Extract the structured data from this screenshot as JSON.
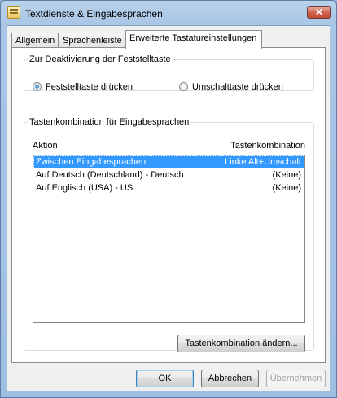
{
  "window": {
    "title": "Textdienste & Eingabesprachen",
    "close_label": "✕"
  },
  "tabs": [
    {
      "label": "Allgemein"
    },
    {
      "label": "Sprachenleiste"
    },
    {
      "label": "Erweiterte Tastatureinstellungen"
    }
  ],
  "capslock": {
    "legend": "Zur Deaktivierung der Feststelltaste",
    "option1": "Feststelltaste drücken",
    "option2": "Umschalttaste drücken"
  },
  "hotkeys": {
    "legend": "Tastenkombination für Eingabesprachen",
    "col_action": "Aktion",
    "col_key": "Tastenkombination",
    "rows": [
      {
        "action": "Zwischen Eingabesprachen",
        "key": "Linke Alt+Umschalt"
      },
      {
        "action": "Auf Deutsch (Deutschland) - Deutsch",
        "key": "(Keine)"
      },
      {
        "action": "Auf Englisch (USA) - US",
        "key": "(Keine)"
      }
    ],
    "change_button": "Tastenkombination ändern..."
  },
  "buttons": {
    "ok": "OK",
    "cancel": "Abbrechen",
    "apply": "Übernehmen"
  }
}
